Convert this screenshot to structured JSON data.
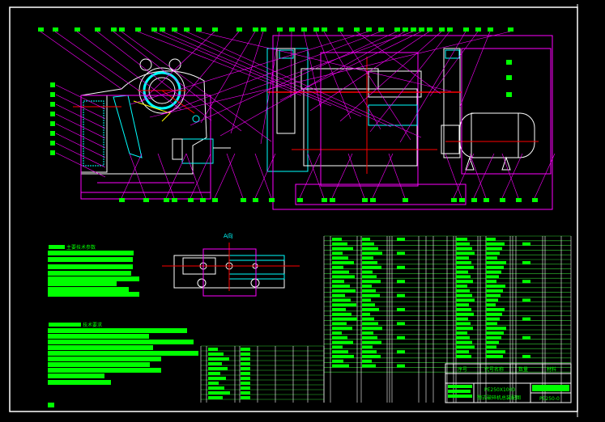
{
  "drawing": {
    "title_model": "PE250X1000",
    "title_name": "颚式破碎机总装配图",
    "drawing_no": "PE250-0",
    "view_label": "A向",
    "tech_params_heading": "主要技术参数",
    "tech_requirements_heading": "技术要求",
    "title_block_headers": [
      "序号",
      "代号",
      "名称",
      "数量",
      "材料"
    ],
    "colors": {
      "background": "#000000",
      "text": "#00ff00",
      "outline": "#ffffff",
      "dimension": "#ff00ff",
      "centerline": "#ff0000",
      "hatch": "#00ffff",
      "dim_text": "#ffff00"
    }
  }
}
